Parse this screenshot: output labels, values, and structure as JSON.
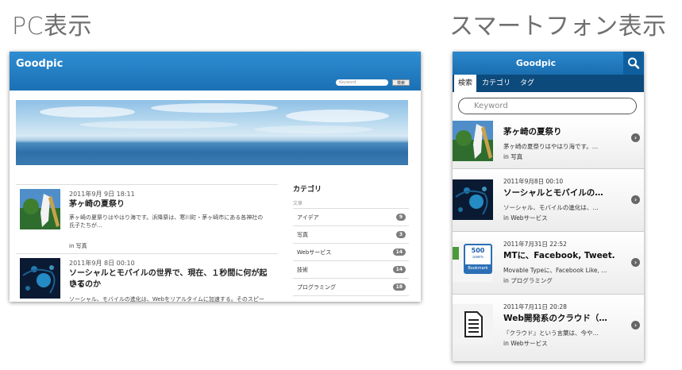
{
  "headings": {
    "pc": "PC表示",
    "smartphone": "スマートフォン表示"
  },
  "pc": {
    "logo": "Goodpic",
    "search_placeholder": "Keyword",
    "search_button": "検索",
    "articles": [
      {
        "date": "2011年9月 9日 18:11",
        "title": "茅ヶ崎の夏祭り",
        "text_lines": [
          "茅ヶ崎の夏祭りはやはり海です。浜降祭は、寒川町・茅ヶ崎市にある各神社の",
          "氏子たちが…"
        ],
        "category": "in 写真"
      },
      {
        "date": "2011年9月 8日 00:10",
        "title_lines": [
          "ソーシャルとモバイルの世界で、現在、１秒間に何が起きて",
          "いるのか"
        ],
        "text_lines": [
          "ソーシャル、モバイルの進化は、Webをリアルタイムに加速する。そのスピー"
        ]
      }
    ],
    "sidebar": {
      "title": "カテゴリ",
      "subtitle": "文章",
      "items": [
        {
          "label": "アイデア",
          "count": "9"
        },
        {
          "label": "写真",
          "count": "3"
        },
        {
          "label": "Webサービス",
          "count": "14"
        },
        {
          "label": "技術",
          "count": "14"
        },
        {
          "label": "プログラミング",
          "count": "18"
        }
      ]
    }
  },
  "sp": {
    "logo": "Goodpic",
    "tabs": [
      "検索",
      "カテゴリ",
      "タグ"
    ],
    "search_placeholder": "Keyword",
    "items": [
      {
        "title": "茅ヶ崎の夏祭り",
        "text": "茅ヶ崎の夏祭りはやはり海です。…",
        "category": "in 写真"
      },
      {
        "date": "2011年9月8日 00:10",
        "title": "ソーシャルとモバイルの…",
        "text": "ソーシャル、モバイルの進化は、…",
        "category": "in Webサービス"
      },
      {
        "date": "2011年7月31日 22:52",
        "title": "MTに、Facebook, Tweet…",
        "text": "Movable Typeに、Facebook Like, …",
        "category": "in プログラミング",
        "thumb": {
          "count": "500",
          "users": "users",
          "label": "Bookmark"
        }
      },
      {
        "date": "2011年7月11日 20:28",
        "title": "Web開発系のクラウド（…",
        "text": "『クラウド』という言葉は、今や…",
        "category": "in Webサービス"
      }
    ]
  },
  "colors": {
    "header_blue": "#1f78c1",
    "tab_dark": "#0d4a7c",
    "badge_gray": "#7d7d7d"
  }
}
